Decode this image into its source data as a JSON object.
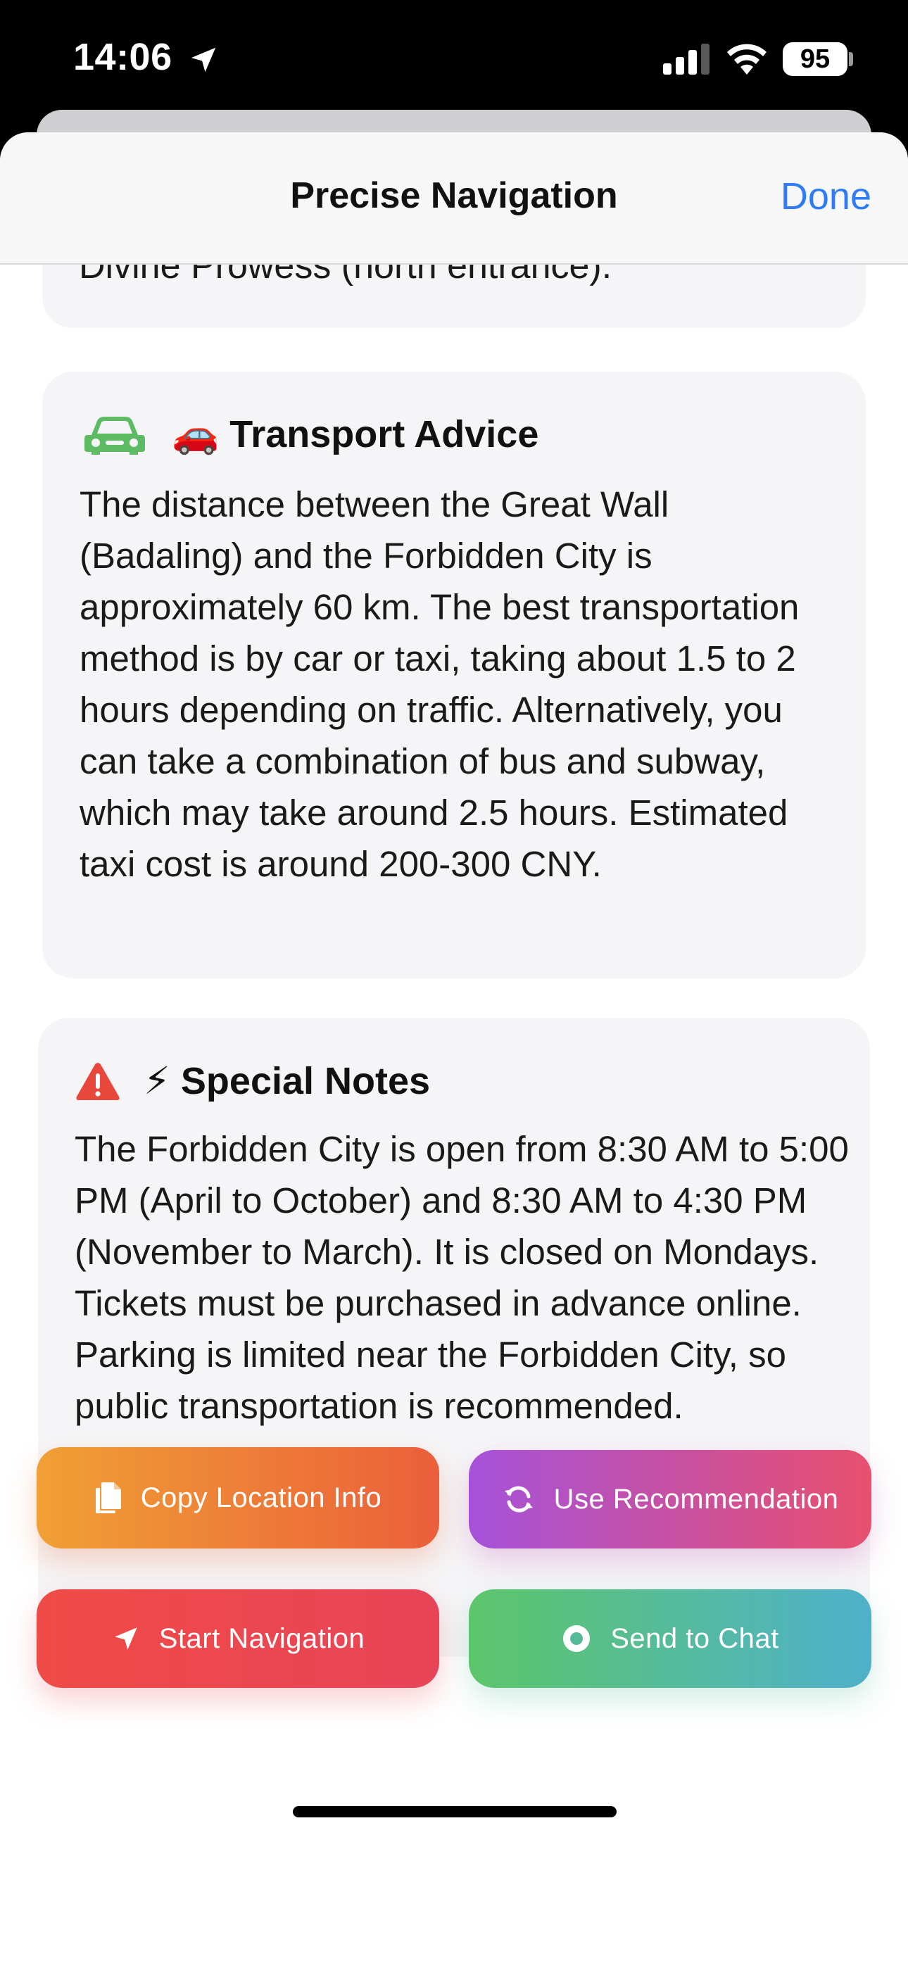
{
  "status_bar": {
    "time": "14:06",
    "battery": "95",
    "icons": [
      "location-arrow-icon",
      "signal-icon",
      "wifi-icon",
      "battery-icon"
    ]
  },
  "nav": {
    "title": "Precise Navigation",
    "done_label": "Done"
  },
  "cards": {
    "previous_tail": "Divine Prowess (north entrance).",
    "transport": {
      "icons": [
        "car-icon",
        "red-car-emoji"
      ],
      "title": "🚗 Transport Advice",
      "body": "The distance between the Great Wall (Badaling) and the Forbidden City is approximately 60 km. The best transportation method is by car or taxi, taking about 1.5 to 2 hours depending on traffic. Alternatively, you can take a combination of bus and subway, which may take around 2.5 hours. Estimated taxi cost is around 200-300 CNY."
    },
    "notes": {
      "icons": [
        "warning-icon",
        "lightning-emoji"
      ],
      "title": "⚡ Special Notes",
      "body": "The Forbidden City is open from 8:30 AM to 5:00 PM (April to October) and 8:30 AM to 4:30 PM (November to March). It is closed on Mondays. Tickets must be purchased in advance online. Parking is limited near the Forbidden City, so public transportation is recommended."
    }
  },
  "actions": {
    "copy": "Copy Location Info",
    "use": "Use Recommendation",
    "start": "Start Navigation",
    "send": "Send to Chat"
  },
  "colors": {
    "accent_blue": "#2f7cf6",
    "copy_gradient": [
      "#f0a035",
      "#eb5f3a"
    ],
    "use_gradient": [
      "#a552d9",
      "#e8506e"
    ],
    "start_gradient": [
      "#ef4b46",
      "#e84458"
    ],
    "send_gradient": [
      "#5dc66a",
      "#4fb0cb"
    ],
    "card_bg": "#f5f5f7"
  }
}
